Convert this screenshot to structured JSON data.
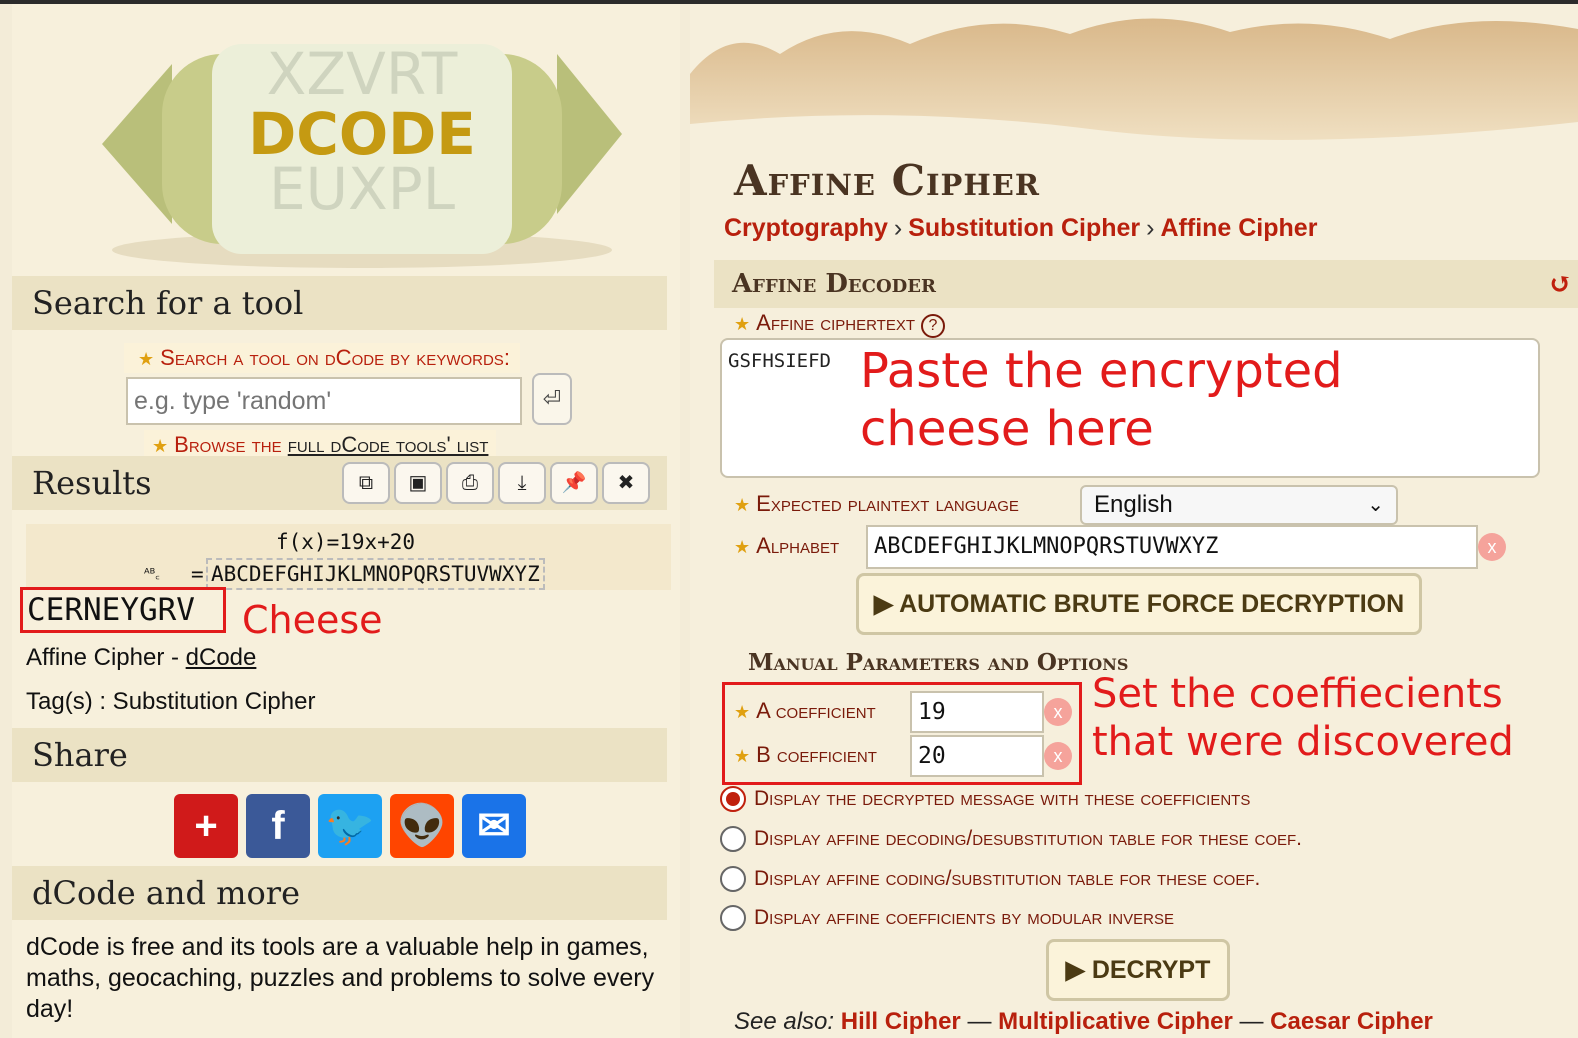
{
  "logo": {
    "brand_text": "DCODE",
    "top_letters": "XZVRT",
    "bottom_letters": "EUXPL"
  },
  "sidebar": {
    "search_heading": "Search for a tool",
    "search_label": "Search a tool on dCode by keywords:",
    "search_placeholder": "e.g. type 'random'",
    "browse_prefix": "Browse the",
    "browse_link": "full dCode tools' list",
    "results_heading": "Results",
    "result_buttons": [
      {
        "icon": "copy-icon",
        "glyph": "⧉"
      },
      {
        "icon": "save-icon",
        "glyph": "▣"
      },
      {
        "icon": "print-icon",
        "glyph": "⎙"
      },
      {
        "icon": "download-icon",
        "glyph": "⤓"
      },
      {
        "icon": "pin-icon",
        "glyph": "📌"
      },
      {
        "icon": "close-icon",
        "glyph": "✖"
      }
    ],
    "formula": "f(x)=19x+20",
    "alphabet_icon": "ᴬᴮ꜀",
    "alphabet_eq": "=",
    "alphabet_value": "ABCDEFGHIJKLMNOPQRSTUVWXYZ",
    "result_word": "CERNEYGRV",
    "cheese_note": "Cheese",
    "result_source_prefix": "Affine Cipher - ",
    "result_source_link": "dCode",
    "result_tags": "Tag(s) : Substitution Cipher",
    "share_heading": "Share",
    "share_buttons": [
      {
        "name": "addthis",
        "glyph": "+",
        "color": "#d01a1a"
      },
      {
        "name": "facebook",
        "glyph": "f",
        "color": "#3b5998"
      },
      {
        "name": "twitter",
        "glyph": "🐦",
        "color": "#1da1f2"
      },
      {
        "name": "reddit",
        "glyph": "👽",
        "color": "#ff4500"
      },
      {
        "name": "email",
        "glyph": "✉",
        "color": "#1a73e8"
      }
    ],
    "more_heading": "dCode and more",
    "about_text": "dCode is free and its tools are a valuable help in games, maths, geocaching, puzzles and problems to solve every day!"
  },
  "main": {
    "title": "Affine Cipher",
    "breadcrumbs": [
      "Cryptography",
      "Substitution Cipher",
      "Affine Cipher"
    ],
    "breadcrumb_sep": "›",
    "decoder_heading": "Affine Decoder",
    "ciphertext_label": "Affine ciphertext",
    "ciphertext_value": "GSFHSIEFD",
    "paste_note_line1": "Paste the encrypted",
    "paste_note_line2": "cheese here",
    "language_label": "Expected plaintext language",
    "language_value": "English",
    "alphabet_label": "Alphabet",
    "alphabet_value": "ABCDEFGHIJKLMNOPQRSTUVWXYZ",
    "brute_force_label": "▶ AUTOMATIC BRUTE FORCE DECRYPTION",
    "manual_heading": "Manual Parameters and Options",
    "a_label": "A coefficient",
    "a_value": "19",
    "b_label": "B coefficient",
    "b_value": "20",
    "coef_note_line1": "Set the coeffiecients",
    "coef_note_line2": "that were discovered",
    "options": [
      {
        "label": "Display the decrypted message with these coefficients",
        "checked": true
      },
      {
        "label": "Display affine decoding/desubstitution table for these coef.",
        "checked": false
      },
      {
        "label": "Display affine coding/substitution table for these coef.",
        "checked": false
      },
      {
        "label": "Display affine coefficients by modular inverse",
        "checked": false
      }
    ],
    "decrypt_label": "▶ DECRYPT",
    "see_also_prefix": "See also:",
    "see_also_links": [
      "Hill Cipher",
      "Multiplicative Cipher",
      "Caesar Cipher"
    ],
    "see_also_sep": "—"
  },
  "colors": {
    "accent_red": "#b8200d",
    "annotation_red": "#e21b1b",
    "parchment": "#f6efdc"
  }
}
